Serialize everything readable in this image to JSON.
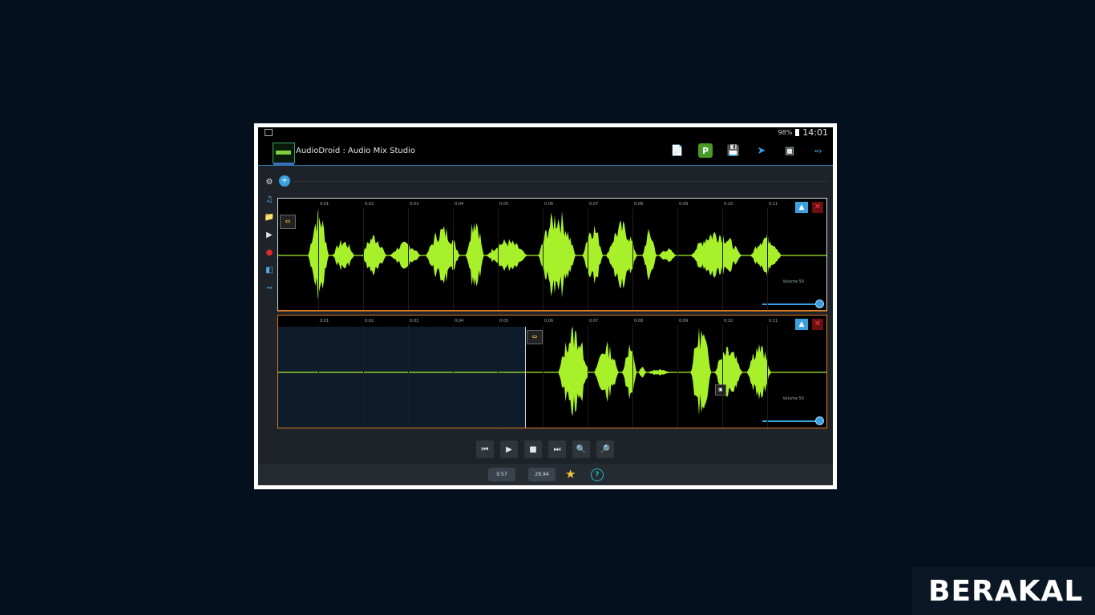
{
  "statusbar": {
    "battery": "98%",
    "clock": "14:01"
  },
  "app": {
    "title": "AudioDroid : Audio Mix Studio"
  },
  "actionbar_icons": [
    "new-file-icon",
    "plugin-icon",
    "save-icon",
    "select-cursor-icon",
    "link-icon",
    "share-icon"
  ],
  "plugin_letter": "P",
  "toolstrip_icons": [
    "settings-icon",
    "music-library-icon",
    "folder-icon",
    "play-icon",
    "record-icon",
    "crop-icon",
    "share-icon"
  ],
  "tracks": [
    {
      "ticks": [
        "0:01",
        "0:02",
        "0:03",
        "0:04",
        "0:05",
        "0:06",
        "0:07",
        "0:08",
        "0:09",
        "0:10",
        "0:11"
      ],
      "volume_label": "Volume 50",
      "volume": 1.0
    },
    {
      "ticks": [
        "0:01",
        "0:02",
        "0:03",
        "0:04",
        "0:05",
        "0:06",
        "0:07",
        "0:08",
        "0:09",
        "0:10",
        "0:11"
      ],
      "volume_label": "Volume 50",
      "volume": 1.0
    }
  ],
  "transport": [
    "skip-back-icon",
    "play-icon",
    "stop-icon",
    "skip-forward-icon",
    "zoom-out-icon",
    "zoom-in-icon"
  ],
  "bottom": {
    "position_time": "0.57",
    "total_time": "29.94"
  },
  "colors": {
    "wave": "#a8f02a",
    "accent": "#3aa0e0",
    "selected_border": "#e07a20"
  },
  "watermark": "BERAKAL"
}
